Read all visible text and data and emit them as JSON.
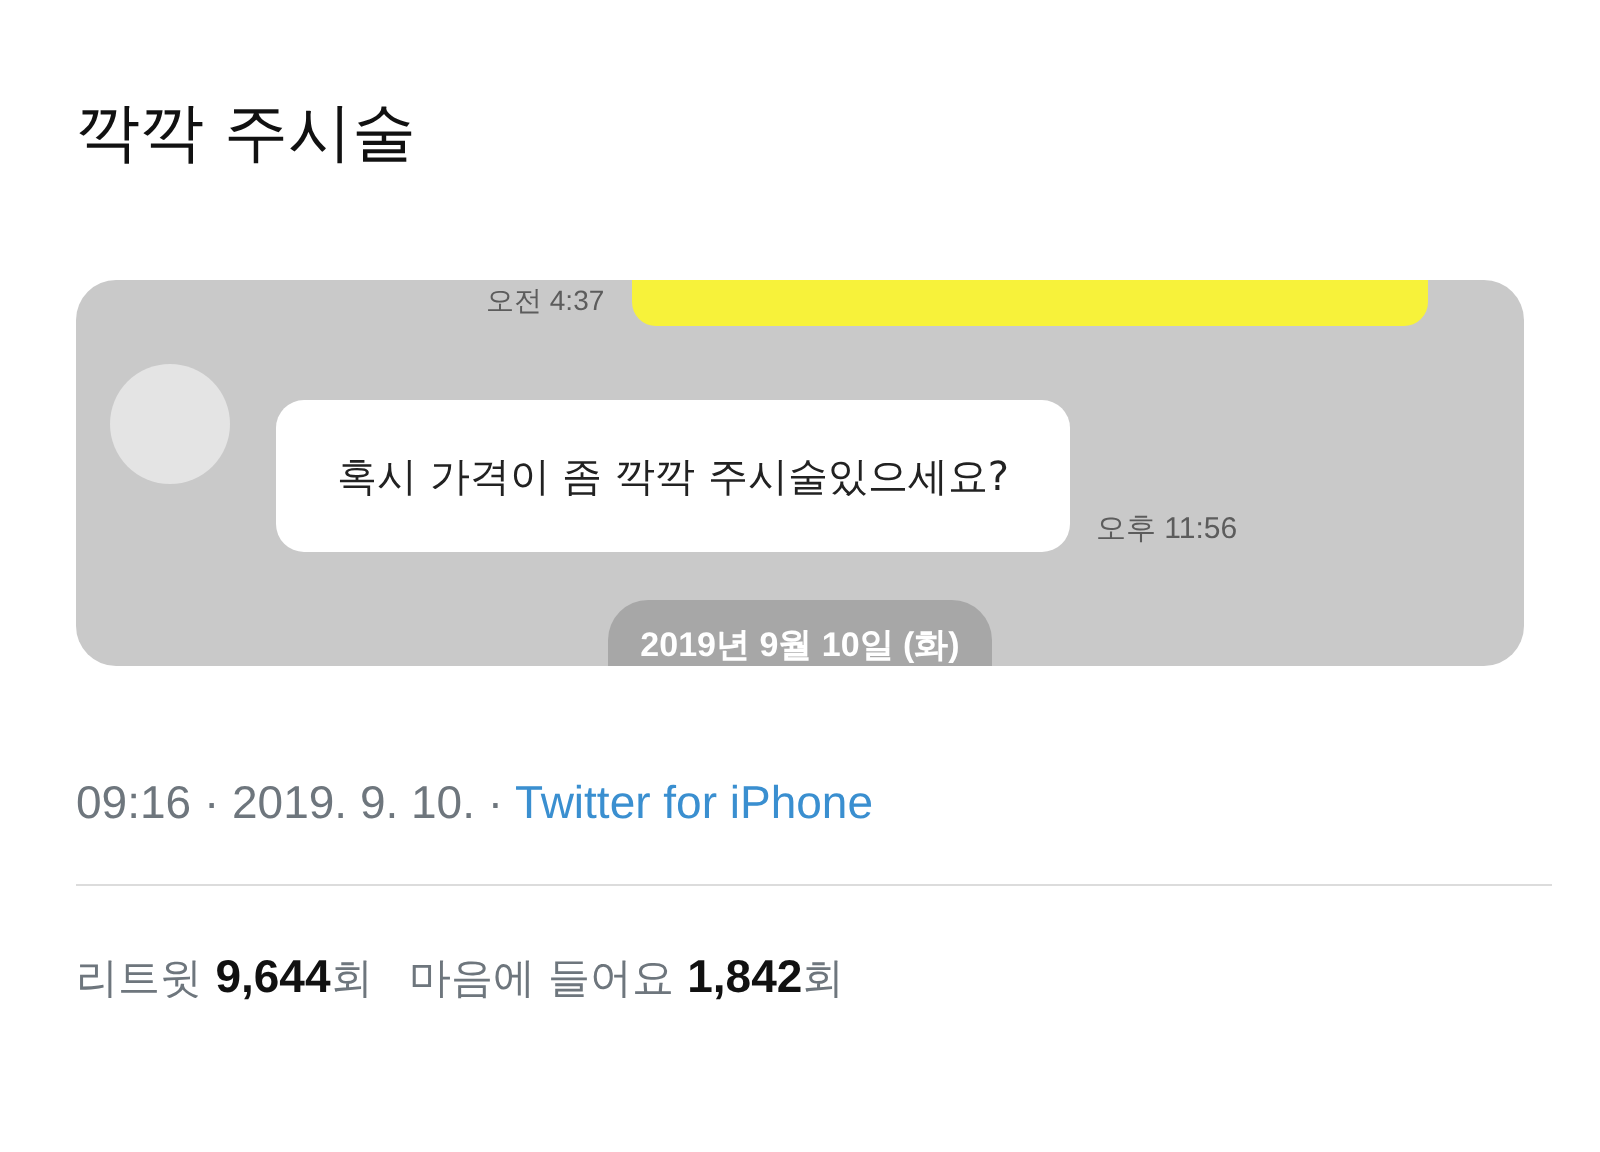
{
  "tweet": {
    "text": "깍깍 주시술",
    "image": {
      "kind": "chat_screenshot",
      "messages": [
        {
          "kind": "sent",
          "time": "오전 4:37"
        },
        {
          "kind": "received",
          "text": "혹시 가격이 좀 깍깍 주시술있으세요?",
          "time": "오후 11:56"
        }
      ],
      "date_divider": "2019년 9월 10일 (화)"
    },
    "meta": "09:16 · 2019. 9. 10. ·",
    "source": "Twitter for iPhone",
    "stats": [
      "리트윗 **9,644**회",
      "마음에 들어요 **1,842**회"
    ]
  }
}
